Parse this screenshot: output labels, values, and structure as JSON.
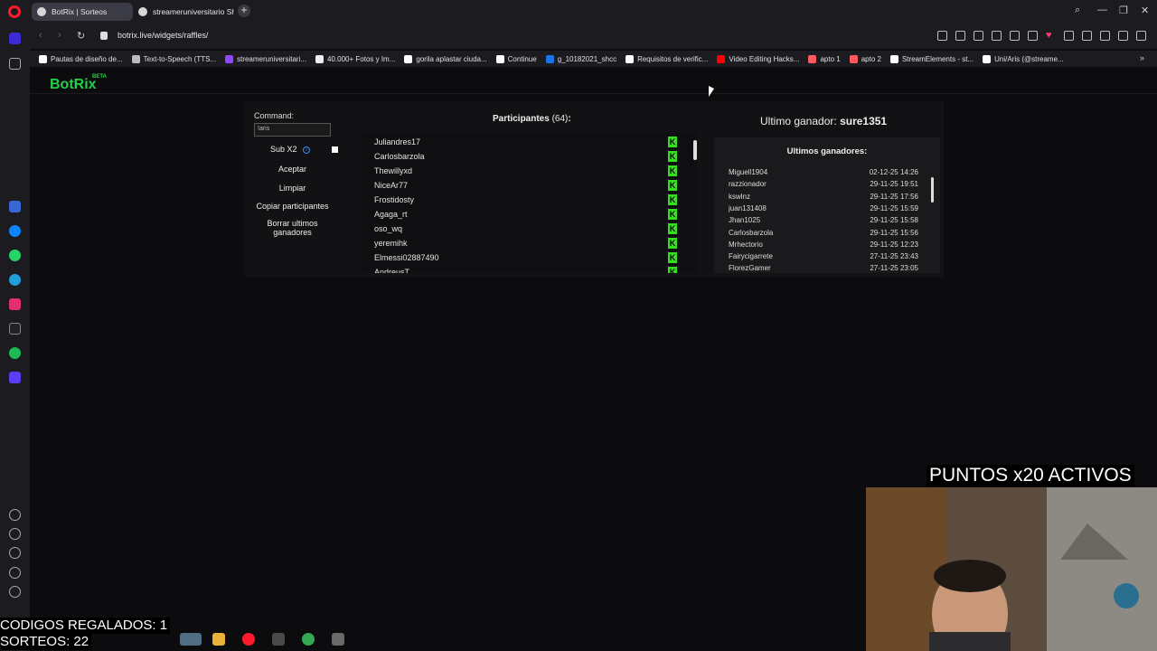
{
  "browser": {
    "tabs": [
      {
        "label": "BotRix | Sorteos",
        "active": true
      },
      {
        "label": "streameruniversitario Shop",
        "active": false
      }
    ],
    "new_tab": "+",
    "url": "botrix.live/widgets/raffles/"
  },
  "bookmarks": [
    {
      "label": "Pautas de diseño de...",
      "icon_color": "#ffffff"
    },
    {
      "label": "Text-to-Speech (TTS...",
      "icon_color": "#bbbbbb"
    },
    {
      "label": "streameruniversitari...",
      "icon_color": "#9146ff"
    },
    {
      "label": "40.000+ Fotos y Im...",
      "icon_color": "#eeeeee"
    },
    {
      "label": "gorila aplastar ciuda...",
      "icon_color": "#ffffff"
    },
    {
      "label": "Continue",
      "icon_color": "#ffffff"
    },
    {
      "label": "g_10182021_shcc",
      "icon_color": "#1a73e8"
    },
    {
      "label": "Requisitos de verific...",
      "icon_color": "#ffffff"
    },
    {
      "label": "Video Editing Hacks...",
      "icon_color": "#ff0000"
    },
    {
      "label": "apto 1",
      "icon_color": "#ff5a5f"
    },
    {
      "label": "apto 2",
      "icon_color": "#ff5a5f"
    },
    {
      "label": "StreamElements - st...",
      "icon_color": "#ffffff"
    },
    {
      "label": "Uni/Aris (@streame...",
      "icon_color": "#ffffff"
    }
  ],
  "app": {
    "logo": "BotRix",
    "beta": "BETA"
  },
  "raffle": {
    "command_label": "Command:",
    "command_value": "!aris",
    "sub_label": "Sub X2",
    "info_icon": "i",
    "accept": "Aceptar",
    "clear": "Limpiar",
    "copy": "Copiar participantes",
    "delete_winners": "Borrar ultimos ganadores"
  },
  "participants": {
    "title": "Participantes",
    "count": "(64)",
    "colon": ":",
    "platform_icon": "kick-icon",
    "list": [
      "Juliandres17",
      "Carlosbarzola",
      "Thewillyxd",
      "NiceAr77",
      "Frostidosty",
      "Agaga_rt",
      "oso_wq",
      "yeremihk",
      "Elmessi02887490",
      "AndreusT"
    ]
  },
  "winner": {
    "label": "Ultimo ganador:",
    "name": "sure1351",
    "history_title": "Ultimos ganadores:",
    "history": [
      {
        "name": "Miguell1904",
        "date": "02-12-25 14:26"
      },
      {
        "name": "razzionador",
        "date": "29-11-25 19:51"
      },
      {
        "name": "kswlnz",
        "date": "29-11-25 17:56"
      },
      {
        "name": "juan131408",
        "date": "29-11-25 15:59"
      },
      {
        "name": "Jhan1025",
        "date": "29-11-25 15:58"
      },
      {
        "name": "Carlosbarzola",
        "date": "29-11-25 15:56"
      },
      {
        "name": "Mrhectorio",
        "date": "29-11-25 12:23"
      },
      {
        "name": "Fairycigarrete",
        "date": "27-11-25 23:43"
      },
      {
        "name": "FlorezGamer",
        "date": "27-11-25 23:05"
      }
    ]
  },
  "overlay": {
    "puntos": "PUNTOS x20 ACTIVOS",
    "codigos": "CODIGOS REGALADOS: 1",
    "sorteos": "SORTEOS: 22"
  },
  "colors": {
    "accent": "#25d04a",
    "kick": "#35e01f",
    "opera": "#ff1b2d"
  }
}
